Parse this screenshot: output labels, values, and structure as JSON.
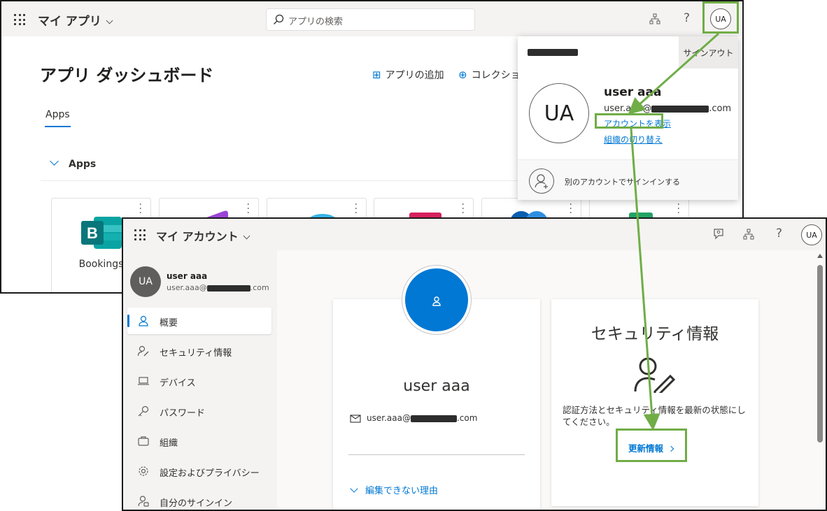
{
  "myapps": {
    "app_title": "マイ アプリ",
    "search_placeholder": "アプリの検索",
    "avatar_initials": "UA",
    "help_label": "?",
    "page_title": "アプリ ダッシュボード",
    "add_app_label": "アプリの追加",
    "collection_label": "コレクショ",
    "tab_apps": "Apps",
    "section_apps": "Apps",
    "tiles": [
      {
        "name": "Bookings",
        "icon": "bookings-icon"
      },
      {
        "name": "",
        "icon": "powerapps-icon"
      },
      {
        "name": "",
        "icon": "sway-icon"
      },
      {
        "name": "",
        "icon": "forms-icon"
      },
      {
        "name": "",
        "icon": "kaizala-icon"
      },
      {
        "name": "",
        "icon": "sheets-icon"
      }
    ]
  },
  "popover": {
    "signout_label": "サインアウト",
    "avatar_initials": "UA",
    "user_name": "user aaa",
    "email_prefix": "user.aaa@",
    "email_suffix": ".com",
    "view_account_link": "アカウントを表示",
    "switch_org_link": "組織の切り替え",
    "other_account_label": "別のアカウントでサインインする"
  },
  "myaccount": {
    "app_title": "マイ アカウント",
    "avatar_initials": "UA",
    "help_label": "?",
    "sidebar": {
      "avatar_initials": "UA",
      "user_name": "user aaa",
      "email_prefix": "user.aaa@",
      "email_suffix": ".com",
      "items": [
        {
          "label": "概要",
          "icon": "person-icon",
          "active": true
        },
        {
          "label": "セキュリティ情報",
          "icon": "security-info-icon",
          "active": false
        },
        {
          "label": "デバイス",
          "icon": "laptop-icon",
          "active": false
        },
        {
          "label": "パスワード",
          "icon": "key-icon",
          "active": false
        },
        {
          "label": "組織",
          "icon": "briefcase-icon",
          "active": false
        },
        {
          "label": "設定およびプライバシー",
          "icon": "gear-icon",
          "active": false
        },
        {
          "label": "自分のサインイン",
          "icon": "signin-icon",
          "active": false
        }
      ]
    },
    "overview_card": {
      "user_name": "user aaa",
      "email_prefix": "user.aaa@",
      "email_suffix": ".com",
      "why_cant_edit": "編集できない理由"
    },
    "security_card": {
      "title": "セキュリティ情報",
      "description": "認証方法とセキュリティ情報を最新の状態にしてください。",
      "update_link": "更新情報"
    }
  },
  "colors": {
    "accent": "#0078d4",
    "annotation": "#70ad47",
    "topbar": "#f4f3f2"
  }
}
